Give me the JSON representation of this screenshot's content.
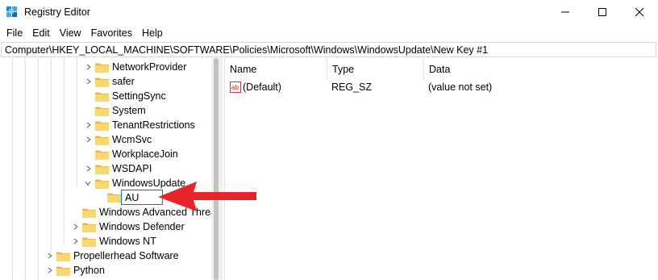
{
  "window": {
    "title": "Registry Editor",
    "icon": "registry-editor-icon"
  },
  "menu": [
    "File",
    "Edit",
    "View",
    "Favorites",
    "Help"
  ],
  "address": "Computer\\HKEY_LOCAL_MACHINE\\SOFTWARE\\Policies\\Microsoft\\Windows\\WindowsUpdate\\New Key #1",
  "tree": {
    "nodes": [
      {
        "label": "NetworkProvider",
        "expanded": false,
        "has_children": true
      },
      {
        "label": "safer",
        "expanded": false,
        "has_children": true
      },
      {
        "label": "SettingSync",
        "expanded": false,
        "has_children": false
      },
      {
        "label": "System",
        "expanded": false,
        "has_children": false
      },
      {
        "label": "TenantRestrictions",
        "expanded": false,
        "has_children": true
      },
      {
        "label": "WcmSvc",
        "expanded": false,
        "has_children": true
      },
      {
        "label": "WorkplaceJoin",
        "expanded": false,
        "has_children": false
      },
      {
        "label": "WSDAPI",
        "expanded": false,
        "has_children": true
      },
      {
        "label": "WindowsUpdate",
        "expanded": true,
        "has_children": true
      },
      {
        "label": "AU",
        "editing": true
      },
      {
        "label": "Windows Advanced Threa",
        "expanded": false,
        "has_children": false
      },
      {
        "label": "Windows Defender",
        "expanded": false,
        "has_children": true
      },
      {
        "label": "Windows NT",
        "expanded": false,
        "has_children": true
      },
      {
        "label": "Propellerhead Software",
        "expanded": false,
        "has_children": true
      },
      {
        "label": "Python",
        "expanded": false,
        "has_children": true
      }
    ]
  },
  "list": {
    "columns": [
      "Name",
      "Type",
      "Data"
    ],
    "rows": [
      {
        "name": "(Default)",
        "type": "REG_SZ",
        "data": "(value not set)",
        "icon": "string-value-icon"
      }
    ]
  },
  "colors": {
    "folder": "#f8d775",
    "folder_dark": "#e8b84a",
    "arrow": "#e8242b",
    "edit_border": "#0078d4"
  }
}
